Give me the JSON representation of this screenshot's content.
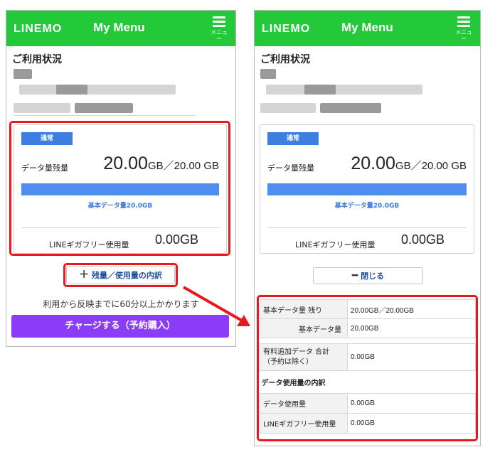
{
  "header": {
    "logo": "LINEMO",
    "title": "My Menu",
    "menu_label": "メニュー"
  },
  "section_title": "ご利用状況",
  "card": {
    "badge": "通常",
    "remaining_label": "データ量残量",
    "remaining_value": "20.00",
    "remaining_suffix": "GB／20.00 GB",
    "fill_fraction": 1.0,
    "bar_label": "基本データ量20.0GB",
    "giga_label": "LINEギガフリー使用量",
    "giga_value": "0.00GB"
  },
  "left_screen": {
    "expand_label": "残量／使用量の内訳",
    "notice": "利用から反映までに60分以上かかります",
    "charge_button": "チャージする（予約購入）"
  },
  "right_screen": {
    "close_label": "閉じる",
    "breakdown": {
      "basic_remaining_label": "基本データ量 残り",
      "basic_remaining_value": "20.00GB／20.00GB",
      "basic_label": "基本データ量",
      "basic_value": "20.00GB",
      "paid_label_1": "有料追加データ 合計",
      "paid_label_2": "（予約は除く）",
      "paid_value": "0.00GB",
      "usage_section": "データ使用量の内訳",
      "data_usage_label": "データ使用量",
      "data_usage_value": "0.00GB",
      "giga_label": "LINEギガフリー使用量",
      "giga_value": "0.00GB"
    }
  },
  "colors": {
    "brand_green": "#24c93a",
    "bar_blue": "#4d8ff0",
    "highlight_red": "#e8181f",
    "charge_purple": "#8b3cf6"
  }
}
